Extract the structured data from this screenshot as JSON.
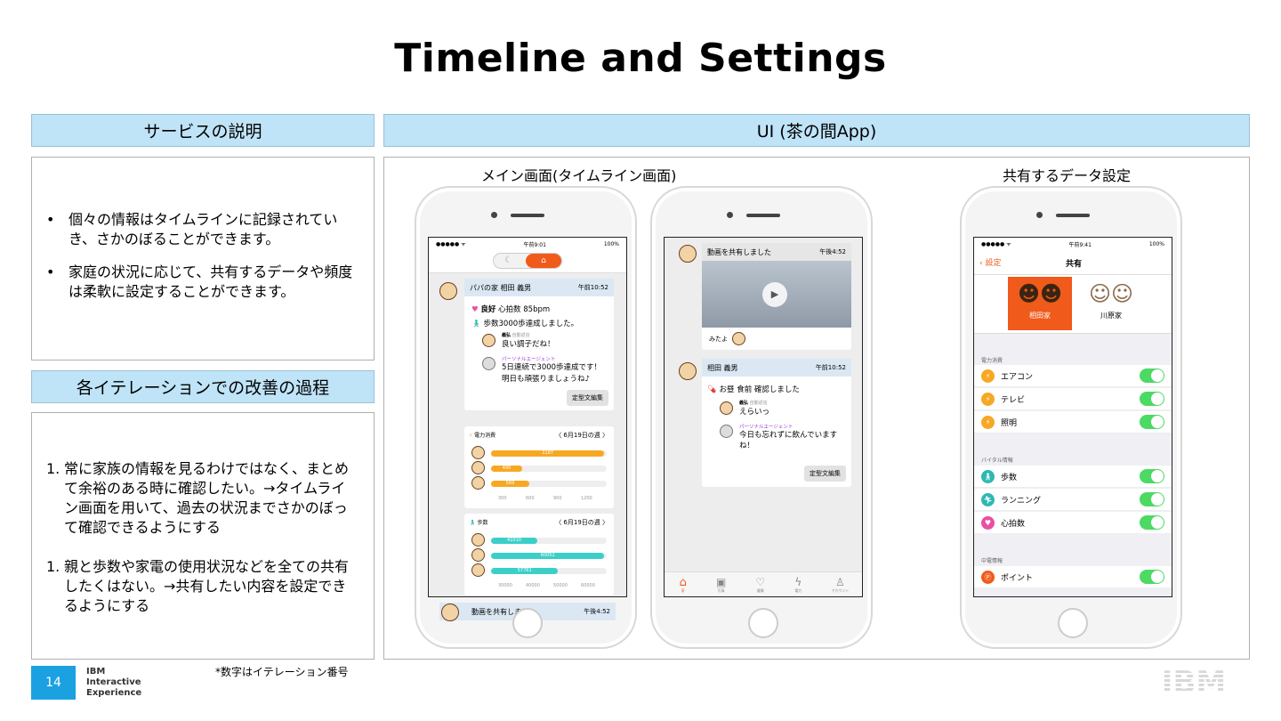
{
  "slide": {
    "title": "Timeline and Settings",
    "page_number": "14",
    "footnote": "*数字はイテレーション番号",
    "brand": [
      "IBM",
      "Interactive",
      "Experience"
    ],
    "ibm_logo": "IBM"
  },
  "left": {
    "service_header": "サービスの説明",
    "bullets": [
      "個々の情報はタイムラインに記録されていき、さかのぼることができます。",
      "家庭の状況に応じて、共有するデータや頻度は柔軟に設定することができます。"
    ],
    "iteration_header": "各イテレーションでの改善の過程",
    "steps": [
      {
        "num": "1.",
        "text": "常に家族の情報を見るわけではなく、まとめて余裕のある時に確認したい。→タイムライン画面を用いて、過去の状況までさかのぼって確認できるようにする"
      },
      {
        "num": "1.",
        "text": "親と歩数や家電の使用状況などを全ての共有したくはない。→共有したい内容を設定できるようにする"
      }
    ]
  },
  "ui": {
    "header": "UI (茶の間App)",
    "main_label": "メイン画面(タイムライン画面)",
    "share_label": "共有するデータ設定"
  },
  "phone1": {
    "status": {
      "carrier": "●●●●● ᯤ",
      "time": "午前9:01",
      "battery": "100%"
    },
    "post_name": "パパの家 相田 義男",
    "post_time": "午前10:52",
    "mood": "良好",
    "heart_rate": "心拍数 85bpm",
    "steps_msg": "歩数3000歩達成しました。",
    "reply1_name": "義弘",
    "reply1_tag": "自動返信",
    "reply1_text": "良い調子だね！",
    "agent_name": "パーソナルエージェント",
    "agent_text1": "5日連続で3000歩達成です！",
    "agent_text2": "明日も頑張りましょうね♪",
    "template_btn": "定型文編集",
    "power_title": "電力消費",
    "week_label": "〈 6月19日の週 〉",
    "power_bars": [
      {
        "value": "1187",
        "frac": 0.98
      },
      {
        "value": "490",
        "frac": 0.27
      },
      {
        "value": "569",
        "frac": 0.33
      }
    ],
    "power_ticks": [
      "300",
      "600",
      "900",
      "1200"
    ],
    "steps_title": "歩数",
    "steps_bars": [
      {
        "value": "41010",
        "frac": 0.4
      },
      {
        "value": "60052",
        "frac": 0.98
      },
      {
        "value": "57761",
        "frac": 0.58
      }
    ],
    "steps_ticks": [
      "30000",
      "40000",
      "50000",
      "60000"
    ],
    "bottom_post": "動画を共有しました",
    "bottom_time": "午後4:52"
  },
  "phone2": {
    "video_title": "動画を共有しました",
    "video_time": "午後4:52",
    "viewer": "みたよ",
    "post_name": "相田 義男",
    "post_time": "午前10:52",
    "pill_msg": "お昼 食前 確認しました",
    "reply_name": "義弘",
    "reply_tag": "自動返信",
    "reply_text": "えらいっ",
    "agent_name": "パーソナルエージェント",
    "agent_text": "今日も忘れずに飲んでいますね！",
    "template_btn": "定型文編集",
    "tabs": [
      "家",
      "写真",
      "健康",
      "電力",
      "アカウント"
    ]
  },
  "phone3": {
    "status": {
      "carrier": "●●●●● ᯤ",
      "time": "午前9:41",
      "battery": "100%"
    },
    "back": "設定",
    "nav_title": "共有",
    "family1": "相田家",
    "family2": "川原家",
    "power_section": "電力消費",
    "power_items": [
      "エアコン",
      "テレビ",
      "照明"
    ],
    "vital_section": "バイタル情報",
    "vital_items": [
      "歩数",
      "ランニング",
      "心拍数"
    ],
    "chuden_section": "中電情報",
    "chuden_items": [
      "ポイント"
    ]
  },
  "colors": {
    "header_bg": "#bfe3f7",
    "accent_orange": "#f05a1a",
    "toggle_green": "#4cd964",
    "bar_orange": "#f7a823",
    "bar_teal": "#3ccfc9"
  }
}
